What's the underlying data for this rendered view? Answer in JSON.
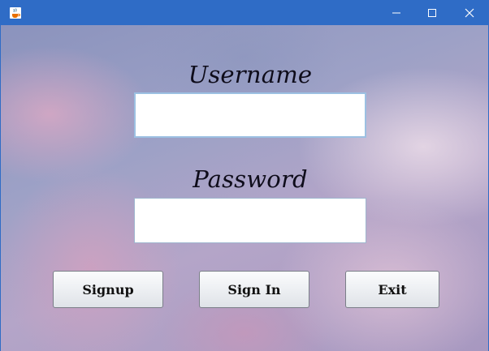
{
  "window": {
    "title": "",
    "app_icon": "java-coffee-cup-icon",
    "controls": {
      "minimize": "minimize-icon",
      "maximize": "maximize-icon",
      "close": "close-icon"
    },
    "titlebar_color": "#2f6cc6"
  },
  "form": {
    "username_label": "Username",
    "username_value": "",
    "password_label": "Password",
    "password_value": ""
  },
  "buttons": {
    "signup": "Signup",
    "signin": "Sign In",
    "exit": "Exit"
  }
}
